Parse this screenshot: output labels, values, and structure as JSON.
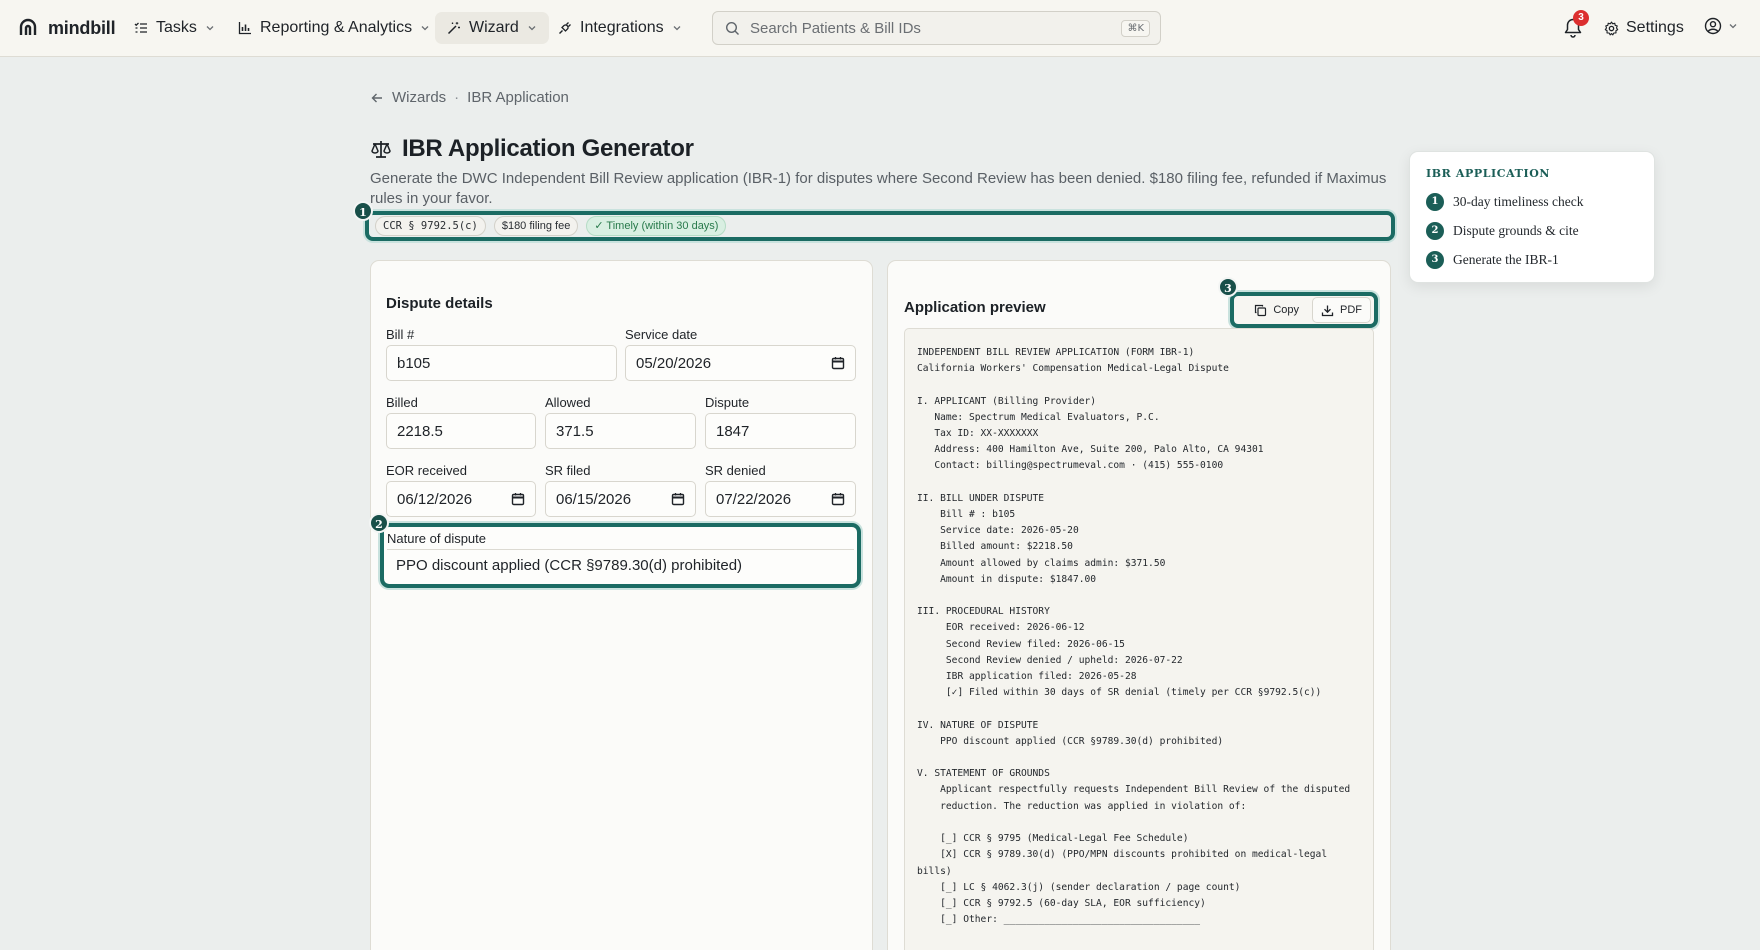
{
  "app": {
    "brand": "mindbill",
    "nav": [
      {
        "label": "Tasks",
        "icon": "list-check-icon"
      },
      {
        "label": "Reporting & Analytics",
        "icon": "bar-chart-icon"
      },
      {
        "label": "Wizard",
        "icon": "magic-wand-icon",
        "active": true
      },
      {
        "label": "Integrations",
        "icon": "plug-icon"
      }
    ],
    "search": {
      "placeholder": "Search Patients & Bill IDs",
      "shortcut": "⌘K"
    },
    "notifications": {
      "count": "3"
    },
    "settings_label": "Settings"
  },
  "breadcrumb": {
    "back": "Wizards",
    "separator": "·",
    "current": "IBR Application"
  },
  "page": {
    "title": "IBR Application Generator",
    "subtitle": "Generate the DWC Independent Bill Review application (IBR-1) for disputes where Second Review has been denied. $180 filing fee, refunded if Maximus rules in your favor.",
    "chips": [
      "CCR § 9792.5(c)",
      "$180 filing fee",
      "✓ Timely (within 30 days)"
    ],
    "chip_colors": {
      "ok_bg": "#d9efe2",
      "ok_text": "#287a4b"
    }
  },
  "steps": [
    "1",
    "2",
    "3"
  ],
  "dispute": {
    "title": "Dispute details",
    "bill_label": "Bill #",
    "bill_value": "b105",
    "service_date_label": "Service date",
    "service_date_value": "05/20/2026",
    "billed_label": "Billed",
    "billed_value": "2218.5",
    "allowed_label": "Allowed",
    "allowed_value": "371.5",
    "dispute_label": "Dispute",
    "dispute_value": "1847",
    "eor_label": "EOR received",
    "eor_value": "06/12/2026",
    "sr_filed_label": "SR filed",
    "sr_filed_value": "06/15/2026",
    "sr_denied_label": "SR denied",
    "sr_denied_value": "07/22/2026",
    "nature_label": "Nature of dispute",
    "nature_value": "PPO discount applied (CCR §9789.30(d) prohibited)"
  },
  "preview": {
    "title": "Application preview",
    "copy_label": "Copy",
    "pdf_label": "PDF",
    "text": "INDEPENDENT BILL REVIEW APPLICATION (FORM IBR-1)\nCalifornia Workers' Compensation Medical-Legal Dispute\n\nI. APPLICANT (Billing Provider)\n   Name: Spectrum Medical Evaluators, P.C.\n   Tax ID: XX-XXXXXXX\n   Address: 400 Hamilton Ave, Suite 200, Palo Alto, CA 94301\n   Contact: billing@spectrumeval.com · (415) 555-0100\n\nII. BILL UNDER DISPUTE\n    Bill # : b105\n    Service date: 2026-05-20\n    Billed amount: $2218.50\n    Amount allowed by claims admin: $371.50\n    Amount in dispute: $1847.00\n\nIII. PROCEDURAL HISTORY\n     EOR received: 2026-06-12\n     Second Review filed: 2026-06-15\n     Second Review denied / upheld: 2026-07-22\n     IBR application filed: 2026-05-28\n     [✓] Filed within 30 days of SR denial (timely per CCR §9792.5(c))\n\nIV. NATURE OF DISPUTE\n    PPO discount applied (CCR §9789.30(d) prohibited)\n\nV. STATEMENT OF GROUNDS\n    Applicant respectfully requests Independent Bill Review of the disputed\n    reduction. The reduction was applied in violation of:\n\n    [_] CCR § 9795 (Medical-Legal Fee Schedule)\n    [X] CCR § 9789.30(d) (PPO/MPN discounts prohibited on medical-legal bills)\n    [_] LC § 4062.3(j) (sender declaration / page count)\n    [_] CCR § 9792.5 (60-day SLA, EOR sufficiency)\n    [_] Other: __________________________________"
  },
  "guide": {
    "title": "IBR APPLICATION",
    "items": [
      "30-day timeliness check",
      "Dispute grounds & cite",
      "Generate the IBR-1"
    ]
  }
}
